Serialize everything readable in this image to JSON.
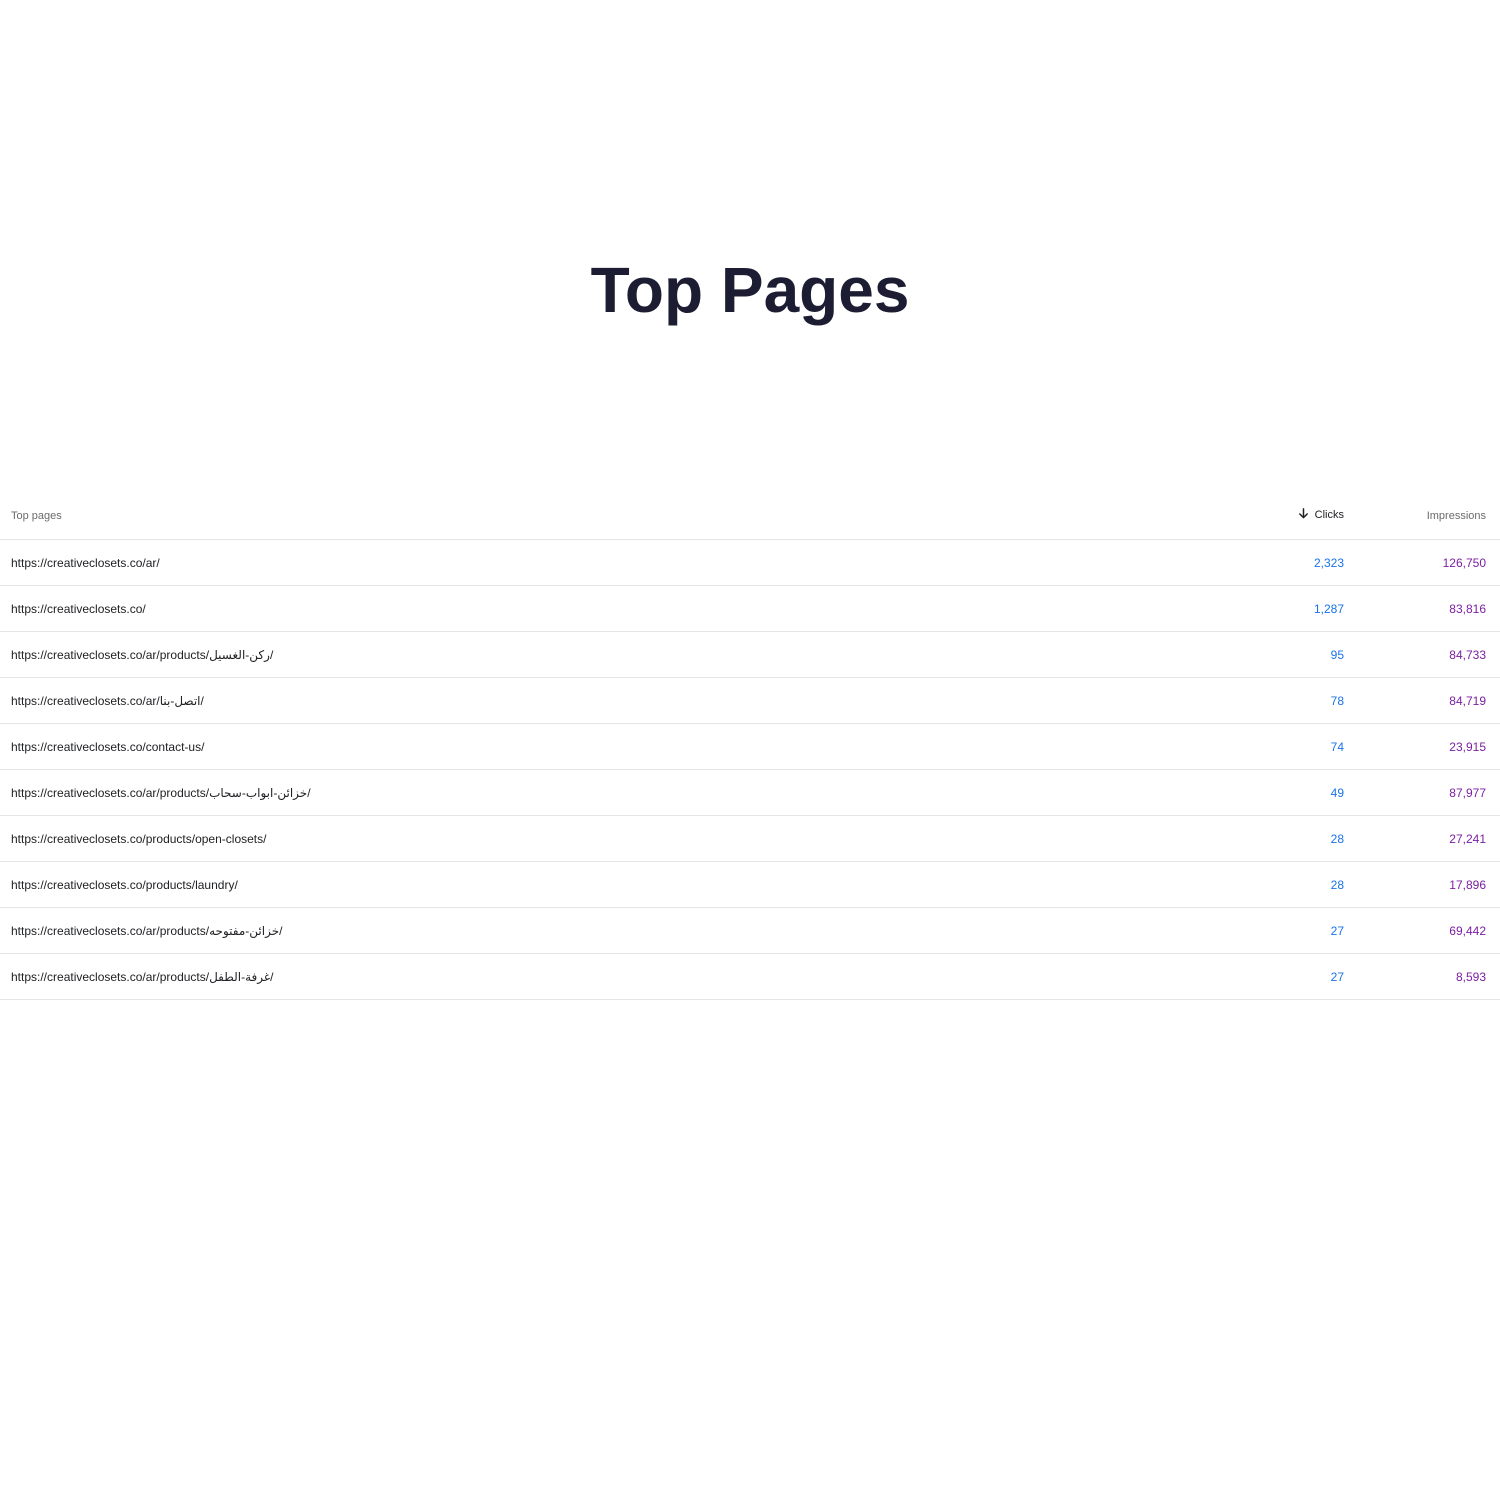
{
  "title": "Top Pages",
  "table": {
    "headers": {
      "page": "Top pages",
      "clicks": "Clicks",
      "impressions": "Impressions"
    },
    "sort_icon": "arrow-down-icon",
    "colors": {
      "clicks": "#1a73e8",
      "impressions": "#7b1fa2"
    },
    "rows": [
      {
        "page": "https://creativeclosets.co/ar/",
        "clicks": "2,323",
        "impressions": "126,750"
      },
      {
        "page": "https://creativeclosets.co/",
        "clicks": "1,287",
        "impressions": "83,816"
      },
      {
        "page": "https://creativeclosets.co/ar/products/ركن-الغسيل/",
        "clicks": "95",
        "impressions": "84,733"
      },
      {
        "page": "https://creativeclosets.co/ar/اتصل-بنا/",
        "clicks": "78",
        "impressions": "84,719"
      },
      {
        "page": "https://creativeclosets.co/contact-us/",
        "clicks": "74",
        "impressions": "23,915"
      },
      {
        "page": "https://creativeclosets.co/ar/products/خزائن-ابواب-سحاب/",
        "clicks": "49",
        "impressions": "87,977"
      },
      {
        "page": "https://creativeclosets.co/products/open-closets/",
        "clicks": "28",
        "impressions": "27,241"
      },
      {
        "page": "https://creativeclosets.co/products/laundry/",
        "clicks": "28",
        "impressions": "17,896"
      },
      {
        "page": "https://creativeclosets.co/ar/products/خزائن-مفتوحه/",
        "clicks": "27",
        "impressions": "69,442"
      },
      {
        "page": "https://creativeclosets.co/ar/products/غرفة-الطفل/",
        "clicks": "27",
        "impressions": "8,593"
      }
    ]
  }
}
